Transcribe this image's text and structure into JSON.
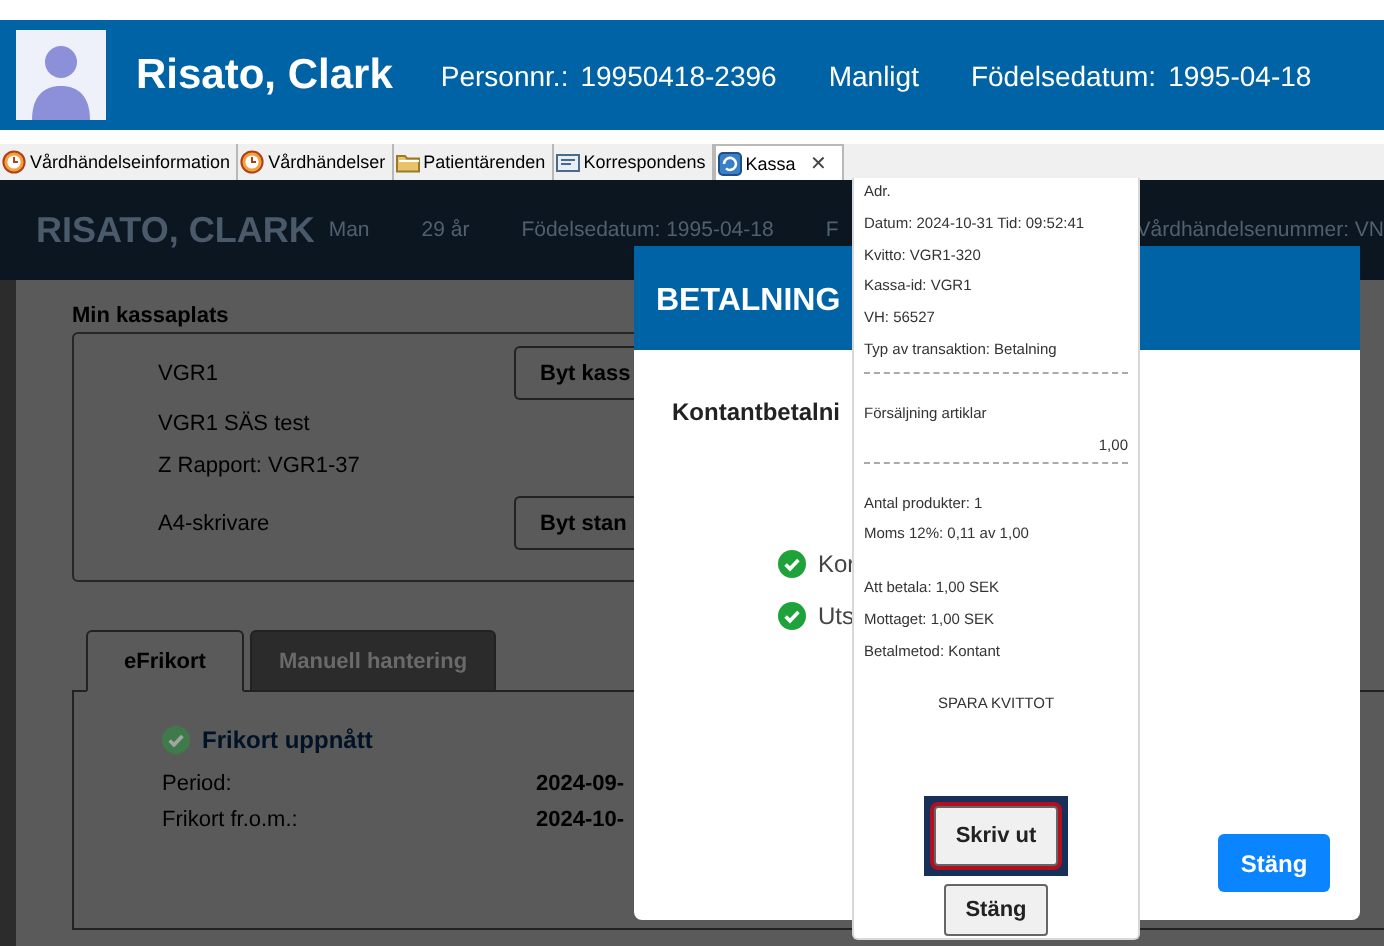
{
  "patient": {
    "name": "Risato, Clark",
    "personnr_label": "Personnr.:",
    "personnr": "19950418-2396",
    "gender": "Manligt",
    "birth_label": "Födelsedatum:",
    "birth": "1995-04-18"
  },
  "tabs": [
    {
      "label": "Vårdhändelseinformation",
      "kind": "clock",
      "selected": false
    },
    {
      "label": "Vårdhändelser",
      "kind": "clock",
      "selected": false
    },
    {
      "label": "Patientärenden",
      "kind": "folder",
      "selected": false
    },
    {
      "label": "Korrespondens",
      "kind": "envelope",
      "selected": false
    },
    {
      "label": "Kassa",
      "kind": "refresh",
      "selected": true,
      "close": "✕"
    }
  ],
  "page_header": {
    "name": "RISATO, CLARK",
    "fields": [
      "Man",
      "29 år",
      "Födelsedatum: 1995-04-18",
      "F",
      "Vårdhändelsenummer: VN"
    ]
  },
  "register": {
    "title": "Min kassaplats",
    "rows": [
      {
        "kind": "button",
        "text": "VGR1",
        "button": "Byt kass"
      },
      {
        "kind": "text",
        "text": "VGR1 SÄS test"
      },
      {
        "kind": "text",
        "text": "Z Rapport: VGR1-37"
      },
      {
        "kind": "button",
        "text": "A4-skrivare",
        "button": "Byt stan"
      }
    ]
  },
  "section_tabs": [
    {
      "label": "eFrikort",
      "selected": true
    },
    {
      "label": "Manuell hantering",
      "selected": false
    }
  ],
  "frikort": {
    "status": "Frikort uppnått",
    "rows": [
      {
        "label": "Period:",
        "value": "2024-09-"
      },
      {
        "label": "Frikort fr.o.m.:",
        "value": "2024-10-"
      }
    ]
  },
  "payment_dialog": {
    "title": "BETALNING",
    "heading": "Kontantbetalni",
    "steps": [
      {
        "text": "Kor",
        "done": true
      },
      {
        "text": "Uts",
        "done": true
      }
    ],
    "close_button": "Stäng"
  },
  "receipt": {
    "lines": [
      {
        "kind": "text",
        "text": "Adr."
      },
      {
        "kind": "text",
        "text": "Datum: 2024-10-31 Tid: 09:52:41"
      },
      {
        "kind": "text",
        "text": "Kvitto: VGR1-320"
      },
      {
        "kind": "text",
        "text": "Kassa-id: VGR1"
      },
      {
        "kind": "text",
        "text": "VH: 56527"
      },
      {
        "kind": "text",
        "text": "Typ av transaktion: Betalning"
      },
      {
        "kind": "rule"
      },
      {
        "kind": "text",
        "text": "Försäljning artiklar"
      },
      {
        "kind": "amount",
        "text": "1,00"
      },
      {
        "kind": "rule"
      },
      {
        "kind": "text",
        "text": "Antal produkter: 1"
      },
      {
        "kind": "text",
        "text": "Moms 12%: 0,11 av 1,00"
      },
      {
        "kind": "text",
        "text": "Att betala: 1,00 SEK",
        "gap_before": true
      },
      {
        "kind": "text",
        "text": "Mottaget: 1,00 SEK"
      },
      {
        "kind": "text",
        "text": "Betalmetod: Kontant"
      }
    ],
    "save_link": "SPARA KVITTOT",
    "print_button": "Skriv ut",
    "print_focused": true,
    "close_button": "Stäng"
  }
}
